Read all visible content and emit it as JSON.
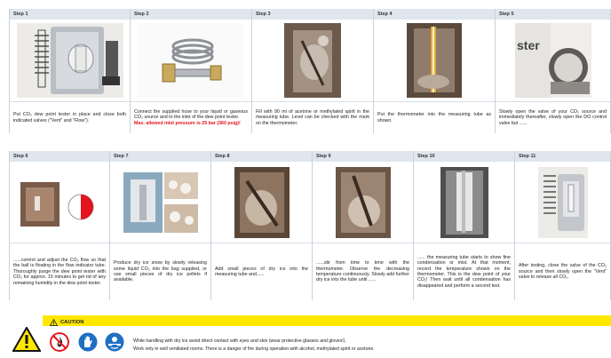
{
  "row1": [
    {
      "label": "Step 1",
      "text": "Put CO₂ dew point tester in place and close both indicated valves (\"Vent\" and \"Flow\")."
    },
    {
      "label": "Step 2",
      "text": "Connect the supplied hose to your liquid or gaseous CO₂ source and to the inlet of the dew point tester.",
      "warning": "Max. allowed inlet pressure is 25 bar (360 psig)!"
    },
    {
      "label": "Step 3",
      "text": "Fill with 90 ml of acetone or methylated spirit in the measuring tube. Level can be checked with the mark on the thermometer."
    },
    {
      "label": "Step 4",
      "text": "Put the thermometer into the measuring tube as shown."
    },
    {
      "label": "Step 5",
      "text": "Slowly open the valve of your CO₂ source and immediately thereafter, slowly open the DO control valve but ......",
      "photo_text": "ster"
    }
  ],
  "row2": [
    {
      "label": "Step 6",
      "text": "......control and adjust the CO₂ flow so that the ball is floating in the flow indicator tube. Thoroughly purge the dew point tester with CO₂ for approx. 15 minutes to get rid of any remaining humidity in the dew point tester."
    },
    {
      "label": "Step 7",
      "text": "Produce dry ice snow by slowly releasing some liquid CO₂ into the bag supplied, or use small pieces of dry ice pellets if available."
    },
    {
      "label": "Step 8",
      "text": "Add small pieces of dry ice into the measuring tube and......"
    },
    {
      "label": "Step 9",
      "text": "......stir from time to time with the thermometer. Observe the decreasing temperature continuously. Slowly add further dry ice into the tube until ......"
    },
    {
      "label": "Step 10",
      "text": "...... the measuring tube starts to show fine condensation or mist. At that moment, record the temperature shown on the thermometer. This is the dew point of your CO₂! Then wait until all condensation has disappeared and perform a second test."
    },
    {
      "label": "Step 11",
      "text": "After testing, close the valve of the CO₂ source and then slowly open the \"Vent\" valve to release all CO₂."
    }
  ],
  "caution": {
    "title": "CAUTION",
    "lines": [
      "While handling with dry ice avoid direct contact with eyes and skin (wear protective glasses and gloves!).",
      "Work only in well ventilated rooms. There is a danger of fire during operation with alcohol, methylated spirit or acetone."
    ]
  },
  "colors": {
    "header": "#dfe6ee",
    "warning": "#e3141b",
    "caution": "#ffe800",
    "ppe_blue": "#1f6fc2"
  },
  "icons": [
    "warning-triangle-icon",
    "no-fire-icon",
    "protective-gloves-icon",
    "safety-glasses-icon"
  ]
}
